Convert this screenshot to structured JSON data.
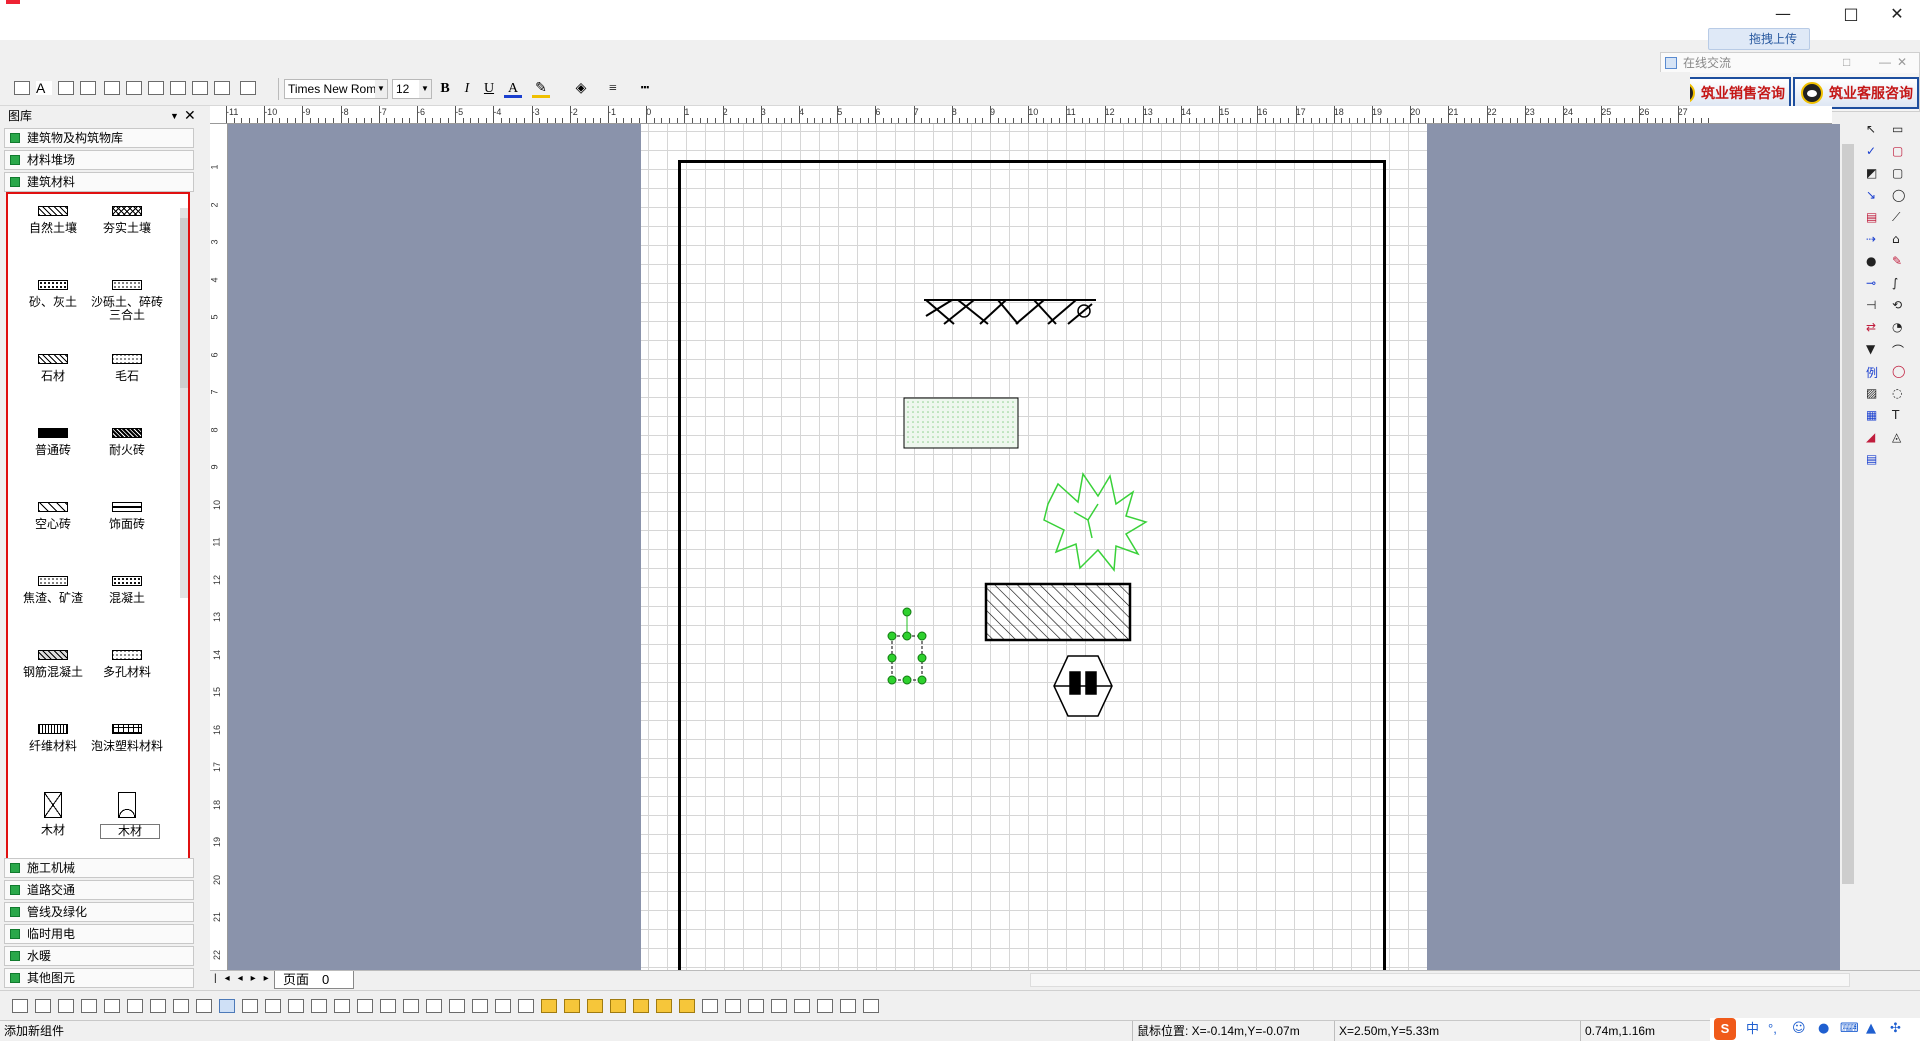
{
  "window": {
    "minimize": "—",
    "maximize": "□",
    "close": "✕"
  },
  "toolbar": {
    "font_name": "Times New Roman",
    "font_size": "12",
    "bold": "B",
    "italic": "I",
    "underline": "U",
    "font_color": "A"
  },
  "online": {
    "upload_label": "拖拽上传",
    "panel_title": "在线交流",
    "sales_consult": "筑业销售咨询",
    "service_consult": "筑业客服咨询"
  },
  "library": {
    "header": "图库",
    "categories_top": [
      "建筑物及构筑物库",
      "材料堆场",
      "建筑材料"
    ],
    "materials": [
      {
        "label": "自然土壤",
        "pattern": "diag"
      },
      {
        "label": "夯实土壤",
        "pattern": "cross"
      },
      {
        "label": "砂、灰土",
        "pattern": "dots"
      },
      {
        "label": "沙砾土、碎砖三合土",
        "pattern": "dots-light"
      },
      {
        "label": "石材",
        "pattern": "diag"
      },
      {
        "label": "毛石",
        "pattern": "stone"
      },
      {
        "label": "普通砖",
        "pattern": "solid"
      },
      {
        "label": "耐火砖",
        "pattern": "diag-dense"
      },
      {
        "label": "空心砖",
        "pattern": "hollow"
      },
      {
        "label": "饰面砖",
        "pattern": "line"
      },
      {
        "label": "焦渣、矿渣",
        "pattern": "dots-light"
      },
      {
        "label": "混凝土",
        "pattern": "dots"
      },
      {
        "label": "钢筋混凝土",
        "pattern": "diag-dots"
      },
      {
        "label": "多孔材料",
        "pattern": "stone"
      },
      {
        "label": "纤维材料",
        "pattern": "wave"
      },
      {
        "label": "泡沫塑料材料",
        "pattern": "grid"
      },
      {
        "label": "木材",
        "pattern": "wood-x"
      },
      {
        "label": "木材",
        "pattern": "wood-arc"
      }
    ],
    "categories_bottom": [
      "施工机械",
      "道路交通",
      "管线及绿化",
      "临时用电",
      "水暖",
      "其他图元"
    ]
  },
  "ruler": {
    "h_labels": [
      "-11",
      "-10",
      "-9",
      "-8",
      "-7",
      "-6",
      "-5",
      "-4",
      "-3",
      "-2",
      "-1",
      "0",
      "1",
      "2",
      "3",
      "4",
      "5",
      "6",
      "7",
      "8",
      "9",
      "10",
      "11",
      "12",
      "13",
      "14",
      "15",
      "16",
      "17",
      "18",
      "19",
      "20",
      "21",
      "22",
      "23",
      "24",
      "25",
      "26",
      "27"
    ],
    "v_labels": [
      "1",
      "2",
      "3",
      "4",
      "5",
      "6",
      "7",
      "8",
      "9",
      "10",
      "11",
      "12",
      "13",
      "14",
      "15",
      "16",
      "17",
      "18",
      "19",
      "20",
      "21",
      "22"
    ]
  },
  "pages": {
    "tab_label": "页面　0"
  },
  "status": {
    "message": "添加新组件",
    "mouse_pos": "鼠标位置: X=-0.14m,Y=-0.07m",
    "object_pos": "X=2.50m,Y=5.33m",
    "object_size": "0.74m,1.16m"
  },
  "ime": {
    "logo": "S",
    "mode": "中",
    "punct": "°,",
    "emoji": "☺",
    "mic": "🎤",
    "keyboard": "⌨",
    "skin": "👕",
    "tools": "✣"
  },
  "colors": {
    "canvas_bg": "#8a93ab",
    "highlight_border": "#e01010",
    "selection_handles": "#22c022",
    "tree_stroke": "#39d139"
  }
}
